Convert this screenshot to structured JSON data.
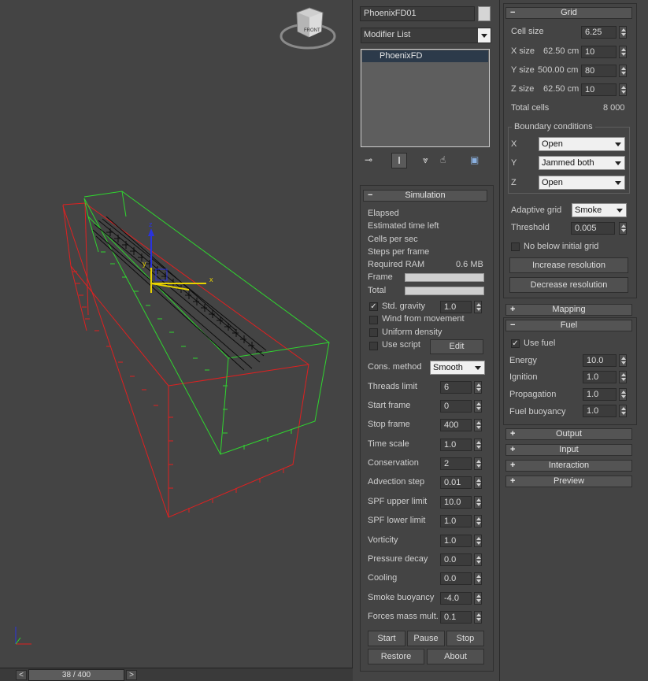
{
  "object_name": "PhoenixFD01",
  "modifier_list_label": "Modifier List",
  "stack_items": [
    "PhoenixFD"
  ],
  "viewcube_label": "FRONT",
  "axis_labels": {
    "x": "x",
    "y": "y",
    "z": "z"
  },
  "timeslider": {
    "value": "38 / 400",
    "prev": "<",
    "next": ">"
  },
  "simulation": {
    "title": "Simulation",
    "collapse": "−",
    "stats": [
      "Elapsed",
      "Estimated time left",
      "Cells per sec",
      "Steps per frame"
    ],
    "required_ram_label": "Required RAM",
    "required_ram_value": "0.6 MB",
    "frame_label": "Frame",
    "total_label": "Total",
    "std_gravity_label": "Std. gravity",
    "std_gravity_value": "1.0",
    "wind_label": "Wind from movement",
    "uniform_density_label": "Uniform density",
    "use_script_label": "Use script",
    "edit_label": "Edit",
    "cons_method_label": "Cons. method",
    "cons_method_value": "Smooth",
    "params": [
      {
        "label": "Threads limit",
        "value": "6"
      },
      {
        "label": "Start frame",
        "value": "0"
      },
      {
        "label": "Stop frame",
        "value": "400"
      },
      {
        "label": "Time scale",
        "value": "1.0"
      },
      {
        "label": "Conservation",
        "value": "2"
      },
      {
        "label": "Advection step",
        "value": "0.01"
      },
      {
        "label": "SPF upper limit",
        "value": "10.0"
      },
      {
        "label": "SPF lower limit",
        "value": "1.0"
      },
      {
        "label": "Vorticity",
        "value": "1.0"
      },
      {
        "label": "Pressure decay",
        "value": "0.0"
      },
      {
        "label": "Cooling",
        "value": "0.0"
      },
      {
        "label": "Smoke buoyancy",
        "value": "-4.0"
      },
      {
        "label": "Forces mass mult.",
        "value": "0.1"
      }
    ],
    "start_label": "Start",
    "pause_label": "Pause",
    "stop_label": "Stop",
    "restore_label": "Restore",
    "about_label": "About"
  },
  "grid": {
    "title": "Grid",
    "collapse": "−",
    "cell_size_label": "Cell size",
    "cell_size_value": "6.25",
    "x_size_label": "X size",
    "x_size_cm": "62.50 cm",
    "x_size_value": "10",
    "y_size_label": "Y size",
    "y_size_cm": "500.00 cm",
    "y_size_value": "80",
    "z_size_label": "Z size",
    "z_size_cm": "62.50 cm",
    "z_size_value": "10",
    "total_cells_label": "Total cells",
    "total_cells_value": "8 000",
    "boundary_title": "Boundary conditions",
    "boundary": [
      {
        "axis": "X",
        "value": "Open"
      },
      {
        "axis": "Y",
        "value": "Jammed both"
      },
      {
        "axis": "Z",
        "value": "Open"
      }
    ],
    "adaptive_label": "Adaptive grid",
    "adaptive_value": "Smoke",
    "threshold_label": "Threshold",
    "threshold_value": "0.005",
    "no_below_label": "No below initial grid",
    "increase_label": "Increase resolution",
    "decrease_label": "Decrease resolution"
  },
  "mapping": {
    "title": "Mapping",
    "expand": "+"
  },
  "fuel": {
    "title": "Fuel",
    "collapse": "−",
    "use_fuel_label": "Use fuel",
    "params": [
      {
        "label": "Energy",
        "value": "10.0"
      },
      {
        "label": "Ignition",
        "value": "1.0"
      },
      {
        "label": "Propagation",
        "value": "1.0"
      },
      {
        "label": "Fuel buoyancy",
        "value": "1.0"
      }
    ]
  },
  "collapsed_rollouts": [
    {
      "title": "Output",
      "expand": "+"
    },
    {
      "title": "Input",
      "expand": "+"
    },
    {
      "title": "Interaction",
      "expand": "+"
    },
    {
      "title": "Preview",
      "expand": "+"
    }
  ],
  "colors": {
    "viewport_bg": "#444444",
    "grid_box_green": "#2fd62f",
    "container_red": "#e02020",
    "gizmo_yellow": "#e8d200",
    "gizmo_blue": "#2a33e0"
  }
}
